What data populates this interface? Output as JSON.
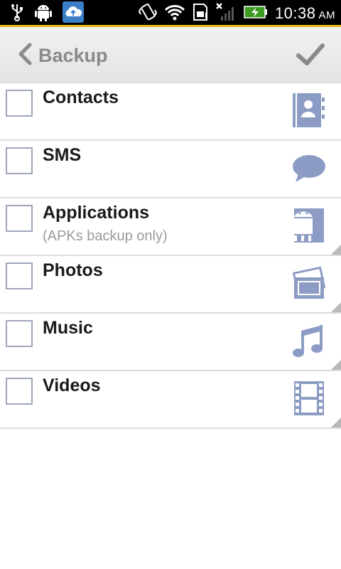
{
  "status": {
    "time": "10:38",
    "ampm": "AM"
  },
  "header": {
    "title": "Backup"
  },
  "items": [
    {
      "label": "Contacts",
      "sub": "",
      "icon": "contacts-icon",
      "checked": false
    },
    {
      "label": "SMS",
      "sub": "",
      "icon": "sms-icon",
      "checked": false
    },
    {
      "label": "Applications",
      "sub": "(APKs backup only)",
      "icon": "android-icon",
      "checked": false
    },
    {
      "label": "Photos",
      "sub": "",
      "icon": "photos-icon",
      "checked": false
    },
    {
      "label": "Music",
      "sub": "",
      "icon": "music-icon",
      "checked": false
    },
    {
      "label": "Videos",
      "sub": "",
      "icon": "film-icon",
      "checked": false
    }
  ],
  "colors": {
    "accent": "#e2b714",
    "icon": "#8d9cc4",
    "checkbox_border": "#9ea5bd"
  }
}
